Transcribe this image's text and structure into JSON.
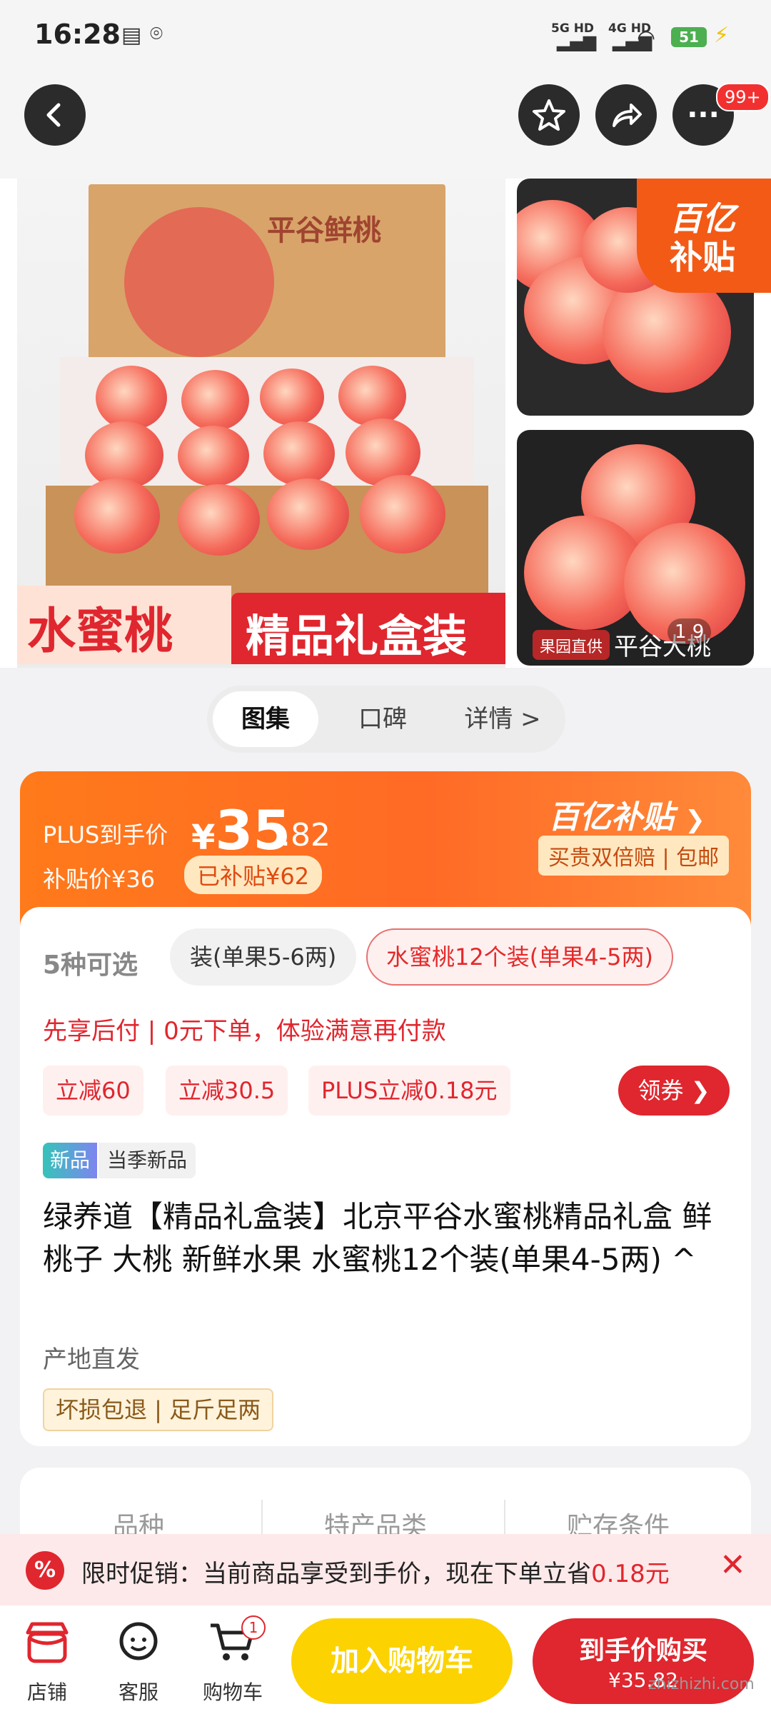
{
  "status_bar": {
    "time": "16:28",
    "network_1": "5G HD",
    "network_2": "4G HD",
    "battery": "51"
  },
  "nav": {
    "notification_badge": "99+"
  },
  "gallery": {
    "box_title": "平谷鲜桃",
    "banner_left": "水蜜桃",
    "banner_right": "精品礼盒装",
    "subsidy_corner_line1": "百亿",
    "subsidy_corner_line2": "补贴",
    "side_tag": "果园直供",
    "side_label": "平谷大桃",
    "pager": "1  9"
  },
  "tabs": [
    {
      "label": "图集"
    },
    {
      "label": "口碑"
    },
    {
      "label": "详情 >"
    }
  ],
  "price": {
    "plus_label": "PLUS到手价",
    "currency": "¥",
    "integer": "35",
    "decimal": ".82",
    "subsidy_price": "补贴价¥36",
    "subsidy_got": "已补贴¥62",
    "brand_logo": "百亿补贴",
    "brand_sub": "买贵双倍赔 | 包邮"
  },
  "spec": {
    "count": "5种可选",
    "option_grey": "装(单果5-6两)",
    "option_selected": "水蜜桃12个装(单果4-5两)"
  },
  "credit_line": "先享后付 | 0元下单，体验满意再付款",
  "coupons": [
    {
      "label": "立减60"
    },
    {
      "label": "立减30.5"
    },
    {
      "label": "PLUS立减0.18元"
    }
  ],
  "coupon_button": "领券",
  "new_badge": "新品",
  "new_label": "当季新品",
  "product_title": "绿养道【精品礼盒装】北京平谷水蜜桃精品礼盒 鲜桃子 大桃 新鲜水果 水蜜桃12个装(单果4-5两) ^",
  "origin": "产地直发",
  "services": "坏损包退 | 足斤足两",
  "attributes": [
    {
      "label": "品种"
    },
    {
      "label": "特产品类"
    },
    {
      "label": "贮存条件"
    }
  ],
  "promo": {
    "text": "限时促销：当前商品享受到手价，现在下单立省",
    "amount": "0.18元"
  },
  "bottom": {
    "shop": "店铺",
    "service": "客服",
    "cart": "购物车",
    "cart_count": "1",
    "add_cart": "加入购物车",
    "buy_now": "到手价购买",
    "buy_price": "¥35.82"
  },
  "watermark": "zhizhizhi.com"
}
